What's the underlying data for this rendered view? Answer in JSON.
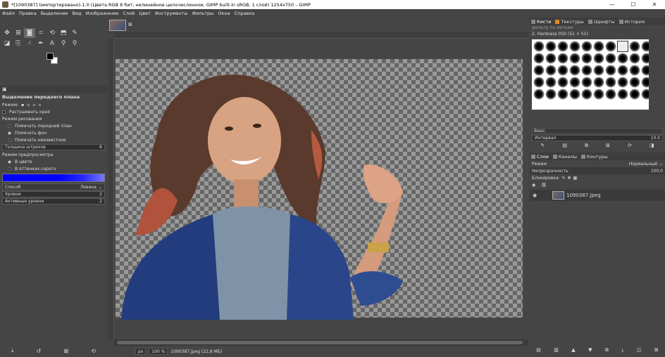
{
  "window": {
    "title": "*[1090387] (импортировано)-1.0 (Цвета RGB 8 бит, нелинейное целочисленное, GIMP built-in sRGB, 1 слой) 1254x750 – GIMP",
    "minimize": "—",
    "maximize": "☐",
    "close": "✕"
  },
  "menu": [
    "Файл",
    "Правка",
    "Выделение",
    "Вид",
    "Изображение",
    "Слой",
    "Цвет",
    "Инструменты",
    "Фильтры",
    "Окна",
    "Справка"
  ],
  "tool_options": {
    "title": "Выделение переднего плана",
    "mode_label": "Режим:",
    "feather_label": "Растушевать края",
    "draw_mode_label": "Режим рисования",
    "draw_modes": [
      "Помечать передний план",
      "Помечать фон",
      "Помечать неизвестное"
    ],
    "stroke_width_label": "Толщина штрихов",
    "stroke_width_value": "6",
    "preview_mode_label": "Режим предпросмотра",
    "preview_modes": [
      "В цвете",
      "В оттенках серого"
    ],
    "engine_label": "Способ",
    "engine_value": "Левина",
    "levels_label": "Уровни",
    "levels_value": "2",
    "active_levels_label": "Активные уровни",
    "active_levels_value": "2"
  },
  "status": {
    "unit": "px",
    "zoom": "100 %",
    "file_info": "1090387.jpeg (22,8 МБ)"
  },
  "right_panel": {
    "tabs": [
      "Кисти",
      "Текстуры",
      "Шрифты",
      "История"
    ],
    "brush_filter": "фильтр по меткам",
    "brush_name": "2. Hardness 050 (51 × 51)",
    "brush_preset": "Basic.",
    "spacing_label": "Интервал",
    "spacing_value": "10.0",
    "layer_tabs": [
      "Слои",
      "Каналы",
      "Контуры"
    ],
    "mode_label": "Режим",
    "mode_value": "Нормальный",
    "opacity_label": "Непрозрачность",
    "opacity_value": "100.0",
    "lock_label": "Блокировка:",
    "layer_name": "1090387.jpeg"
  }
}
